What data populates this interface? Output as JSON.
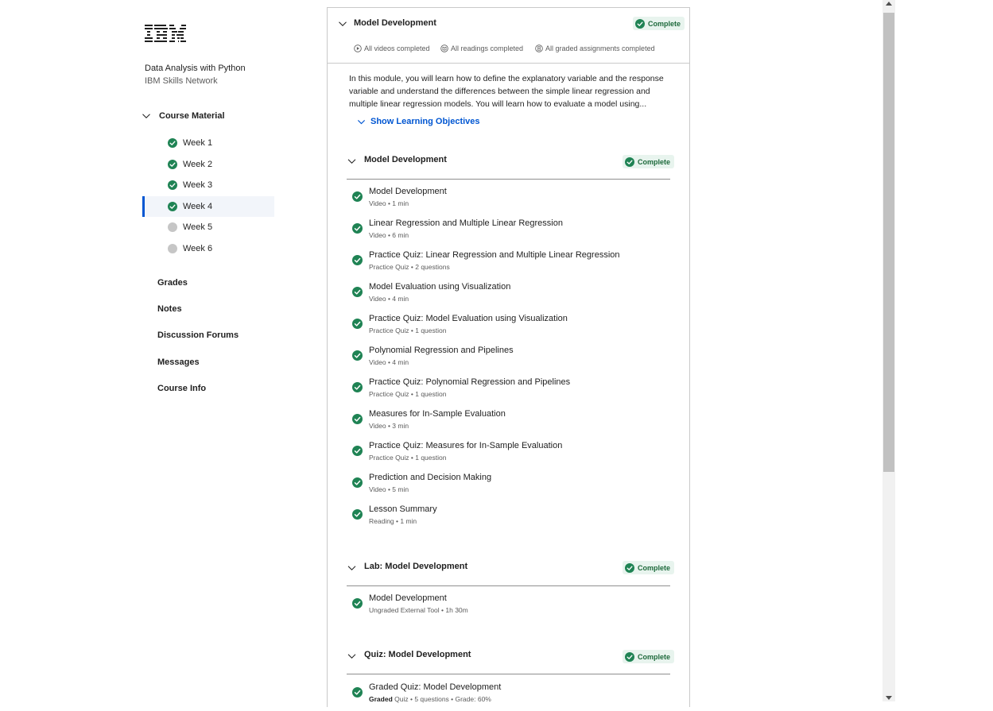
{
  "brand": {
    "logo_text": "IBM"
  },
  "course": {
    "title": "Data Analysis with Python",
    "org": "IBM Skills Network"
  },
  "sidebar": {
    "course_material_label": "Course Material",
    "weeks": [
      {
        "label": "Week 1",
        "status": "complete"
      },
      {
        "label": "Week 2",
        "status": "complete"
      },
      {
        "label": "Week 3",
        "status": "complete"
      },
      {
        "label": "Week 4",
        "status": "complete",
        "active": true
      },
      {
        "label": "Week 5",
        "status": "incomplete"
      },
      {
        "label": "Week 6",
        "status": "incomplete"
      }
    ],
    "links": [
      "Grades",
      "Notes",
      "Discussion Forums",
      "Messages",
      "Course Info"
    ]
  },
  "module": {
    "title": "Model Development",
    "badge": "Complete",
    "stats": [
      "All videos completed",
      "All readings completed",
      "All graded assignments completed"
    ],
    "description": "In this module, you will learn how to define the explanatory variable and the response variable and understand the differences between the simple linear regression and multiple linear regression models. You will learn how to evaluate a model using...",
    "objectives_label": "Show Learning Objectives"
  },
  "sections": [
    {
      "title": "Model Development",
      "badge": "Complete",
      "items": [
        {
          "title": "Model Development",
          "meta": "Video • 1 min"
        },
        {
          "title": "Linear Regression and Multiple Linear Regression",
          "meta": "Video • 6 min"
        },
        {
          "title": "Practice Quiz: Linear Regression and Multiple Linear Regression",
          "meta": "Practice Quiz • 2 questions"
        },
        {
          "title": "Model Evaluation using Visualization",
          "meta": "Video • 4 min"
        },
        {
          "title": "Practice Quiz: Model Evaluation using Visualization",
          "meta": "Practice Quiz • 1 question"
        },
        {
          "title": "Polynomial Regression and Pipelines",
          "meta": "Video • 4 min"
        },
        {
          "title": "Practice Quiz: Polynomial Regression and Pipelines",
          "meta": "Practice Quiz • 1 question"
        },
        {
          "title": "Measures for In-Sample Evaluation",
          "meta": "Video • 3 min"
        },
        {
          "title": "Practice Quiz: Measures for In-Sample Evaluation",
          "meta": "Practice Quiz • 1 question"
        },
        {
          "title": "Prediction and Decision Making",
          "meta": "Video • 5 min"
        },
        {
          "title": "Lesson Summary",
          "meta": "Reading • 1 min"
        }
      ]
    },
    {
      "title": "Lab: Model Development",
      "badge": "Complete",
      "items": [
        {
          "title": "Model Development",
          "meta": "Ungraded External Tool • 1h 30m"
        }
      ]
    },
    {
      "title": "Quiz: Model Development",
      "badge": "Complete",
      "items": [
        {
          "title": "Graded Quiz: Model Development",
          "meta_strong": "Graded",
          "meta": "Quiz • 5 questions • Grade: 60%"
        }
      ]
    }
  ],
  "colors": {
    "complete_green": "#1f8354",
    "link_blue": "#0056d2",
    "incomplete_gray": "#c6c6c6"
  }
}
